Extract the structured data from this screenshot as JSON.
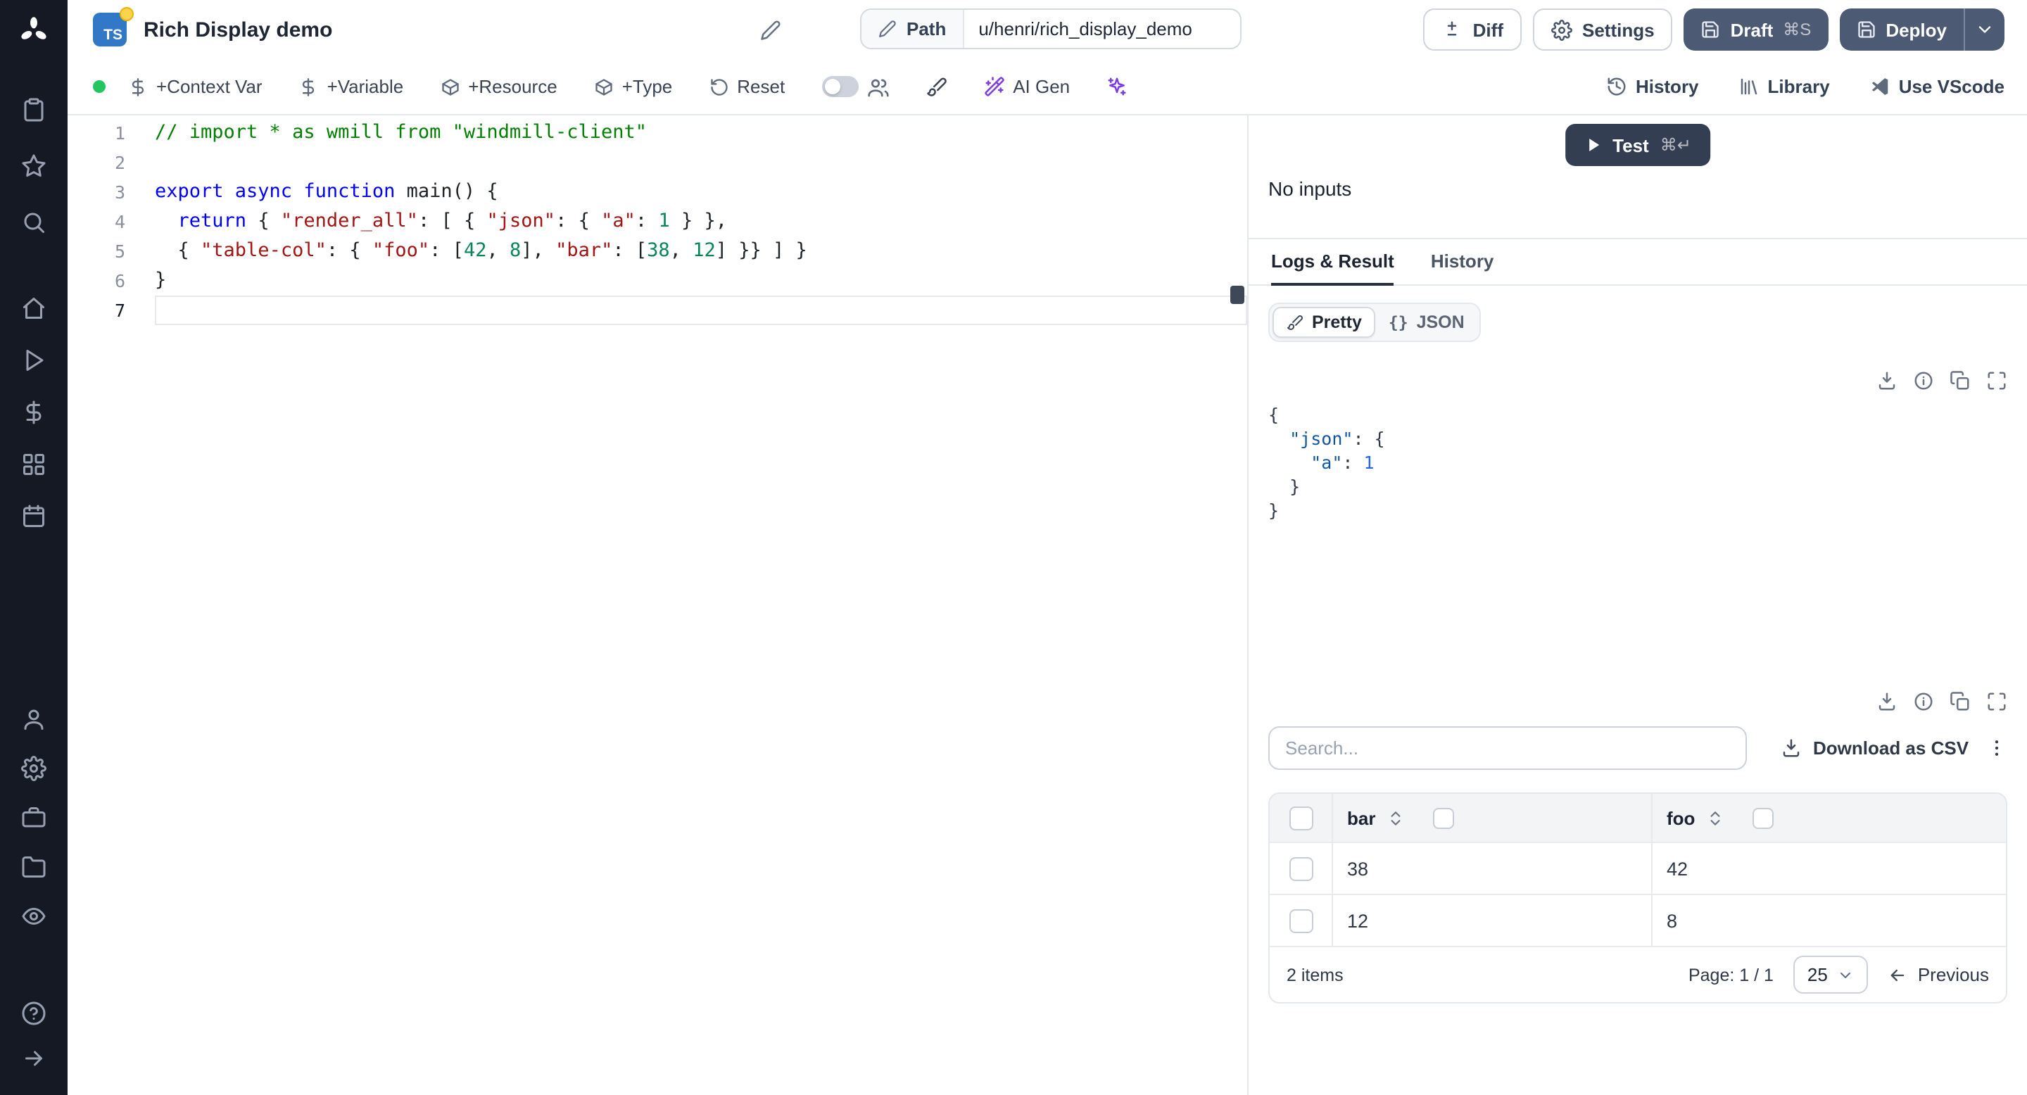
{
  "sidebar": {
    "groups": [
      [
        "clipboard",
        "star",
        "search"
      ],
      [
        "home",
        "play",
        "dollar",
        "apps",
        "calendar"
      ],
      [
        "user",
        "gear",
        "briefcase",
        "folder",
        "eye"
      ],
      [
        "help",
        "arrow-right"
      ]
    ]
  },
  "header": {
    "lang_badge": "TS",
    "title": "Rich Display demo",
    "path_label": "Path",
    "path_value": "u/henri/rich_display_demo",
    "diff_label": "Diff",
    "settings_label": "Settings",
    "draft_label": "Draft",
    "draft_shortcut": "⌘S",
    "deploy_label": "Deploy"
  },
  "toolbar": {
    "context_var": "+Context Var",
    "variable": "+Variable",
    "resource": "+Resource",
    "type": "+Type",
    "reset": "Reset",
    "ai_gen": "AI Gen",
    "history": "History",
    "library": "Library",
    "vscode": "Use VScode"
  },
  "editor": {
    "lines": [
      {
        "num": "1",
        "segments": [
          {
            "c": "comment",
            "t": "// import * as wmill from \"windmill-client\""
          }
        ]
      },
      {
        "num": "2",
        "segments": []
      },
      {
        "num": "3",
        "segments": [
          {
            "c": "kw",
            "t": "export async function "
          },
          {
            "c": "plain",
            "t": "main() {"
          }
        ]
      },
      {
        "num": "4",
        "segments": [
          {
            "c": "plain",
            "t": "  "
          },
          {
            "c": "kw",
            "t": "return"
          },
          {
            "c": "plain",
            "t": " { "
          },
          {
            "c": "str",
            "t": "\"render_all\""
          },
          {
            "c": "plain",
            "t": ": [ { "
          },
          {
            "c": "str",
            "t": "\"json\""
          },
          {
            "c": "plain",
            "t": ": { "
          },
          {
            "c": "str",
            "t": "\"a\""
          },
          {
            "c": "plain",
            "t": ": "
          },
          {
            "c": "num",
            "t": "1"
          },
          {
            "c": "plain",
            "t": " } },"
          }
        ]
      },
      {
        "num": "5",
        "segments": [
          {
            "c": "plain",
            "t": "  { "
          },
          {
            "c": "str",
            "t": "\"table-col\""
          },
          {
            "c": "plain",
            "t": ": { "
          },
          {
            "c": "str",
            "t": "\"foo\""
          },
          {
            "c": "plain",
            "t": ": ["
          },
          {
            "c": "num",
            "t": "42"
          },
          {
            "c": "plain",
            "t": ", "
          },
          {
            "c": "num",
            "t": "8"
          },
          {
            "c": "plain",
            "t": "], "
          },
          {
            "c": "str",
            "t": "\"bar\""
          },
          {
            "c": "plain",
            "t": ": ["
          },
          {
            "c": "num",
            "t": "38"
          },
          {
            "c": "plain",
            "t": ", "
          },
          {
            "c": "num",
            "t": "12"
          },
          {
            "c": "plain",
            "t": "] }} ] }"
          }
        ]
      },
      {
        "num": "6",
        "segments": [
          {
            "c": "plain",
            "t": "}"
          }
        ]
      },
      {
        "num": "7",
        "segments": [],
        "current": true
      }
    ]
  },
  "run": {
    "test_label": "Test",
    "test_shortcut": "⌘↵",
    "no_inputs": "No inputs"
  },
  "tabs": {
    "logs": "Logs & Result",
    "history": "History"
  },
  "result": {
    "pretty": "Pretty",
    "json": "JSON",
    "json_glyph": "{}",
    "toolbar_icons": [
      "download",
      "info",
      "copy",
      "expand"
    ],
    "json_lines": [
      [
        {
          "c": "p",
          "t": "{"
        }
      ],
      [
        {
          "c": "p",
          "t": "  "
        },
        {
          "c": "key",
          "t": "\"json\""
        },
        {
          "c": "p",
          "t": ": {"
        }
      ],
      [
        {
          "c": "p",
          "t": "    "
        },
        {
          "c": "key",
          "t": "\"a\""
        },
        {
          "c": "p",
          "t": ": "
        },
        {
          "c": "num",
          "t": "1"
        }
      ],
      [
        {
          "c": "p",
          "t": "  }"
        }
      ],
      [
        {
          "c": "p",
          "t": "}"
        }
      ]
    ]
  },
  "table": {
    "search_placeholder": "Search...",
    "csv_label": "Download as CSV",
    "columns": [
      "bar",
      "foo"
    ],
    "rows": [
      [
        "38",
        "42"
      ],
      [
        "12",
        "8"
      ]
    ],
    "items_text": "2 items",
    "page_text": "Page: 1 / 1",
    "page_size": "25",
    "previous_label": "Previous"
  },
  "colors": {
    "ts_badge": "#3178c6",
    "dark_button": "#4d5a73",
    "test_button": "#333e52",
    "status_green": "#22c55e",
    "accent_purple": "#7c3aed"
  }
}
